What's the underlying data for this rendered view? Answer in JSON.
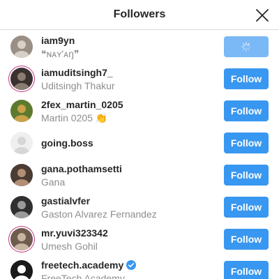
{
  "header": {
    "title": "Followers"
  },
  "followers": [
    {
      "username": "iam9yn",
      "full_name": "❝ɴᴀʏ'ᴀŋ❞",
      "button": "",
      "state": "loading",
      "avatar_colors": [
        "#9a8f85",
        "#d8d0c6"
      ],
      "ring": false,
      "verified": false
    },
    {
      "username": "iamuditsingh7_",
      "full_name": "Uditsingh Thakur",
      "button": "Follow",
      "state": "follow",
      "avatar_colors": [
        "#3a3230",
        "#8a7c70"
      ],
      "ring": true,
      "verified": false
    },
    {
      "username": "2fex_martin_0205",
      "full_name": "Martin 0205 👏",
      "button": "Follow",
      "state": "follow",
      "avatar_colors": [
        "#5c7a2e",
        "#c9a24a"
      ],
      "ring": false,
      "verified": false
    },
    {
      "username": "going.boss",
      "full_name": "",
      "button": "Follow",
      "state": "follow",
      "avatar_colors": [
        "#efefef",
        "#d6d6d6"
      ],
      "ring": false,
      "verified": false
    },
    {
      "username": "gana.pothamsetti",
      "full_name": "Gana",
      "button": "Follow",
      "state": "follow",
      "avatar_colors": [
        "#4a3b33",
        "#b38f76"
      ],
      "ring": false,
      "verified": false
    },
    {
      "username": "gastialvfer",
      "full_name": "Gaston Alvarez Fernandez",
      "button": "Follow",
      "state": "follow",
      "avatar_colors": [
        "#2f2f2f",
        "#9a9a9a"
      ],
      "ring": false,
      "verified": false
    },
    {
      "username": "mr.yuvi323342",
      "full_name": "Umesh Gohil",
      "button": "Follow",
      "state": "follow",
      "avatar_colors": [
        "#6e5c4f",
        "#c8b4a0"
      ],
      "ring": true,
      "verified": false
    },
    {
      "username": "freetech.academy",
      "full_name": "FreeTech Academy",
      "button": "Follow",
      "state": "follow",
      "avatar_colors": [
        "#1a1a1a",
        "#ffffff"
      ],
      "ring": false,
      "verified": true
    }
  ],
  "colors": {
    "accent": "#3897f0",
    "loading": "#7ab9f5",
    "muted": "#8e8e8e",
    "text": "#262626",
    "verified": "#3897f0"
  }
}
